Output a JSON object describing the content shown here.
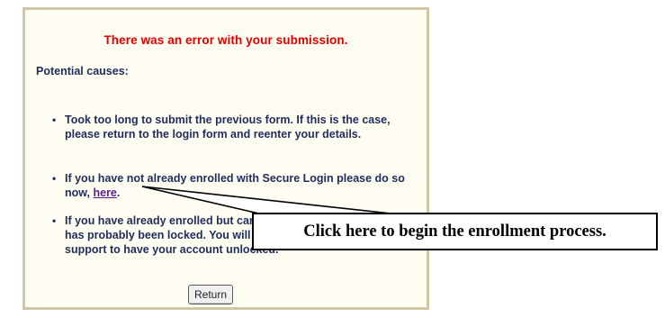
{
  "error_box": {
    "title": "There was an error with your submission.",
    "causes_heading": "Potential causes:",
    "causes": [
      {
        "text": "Took too long to submit the previous form. If this is the case, please return to the login form and reenter your details."
      },
      {
        "text_before_link": "If you have not already enrolled with Secure Login please do so now, ",
        "link_label": "here",
        "text_after_link": "."
      },
      {
        "text": "If you have already enrolled but cannot login, then your account has probably been locked. You will need to contact customer support to have your account unlocked."
      }
    ],
    "return_button_label": "Return"
  },
  "callout": {
    "text": "Click here to begin the enrollment process."
  },
  "colors": {
    "title": "#e00000",
    "body_text": "#1f2d5c",
    "link": "#5b1e8a",
    "panel_border": "#cfc6a4",
    "panel_background": "#fffdf1"
  },
  "icons": {
    "bullet": "•"
  }
}
